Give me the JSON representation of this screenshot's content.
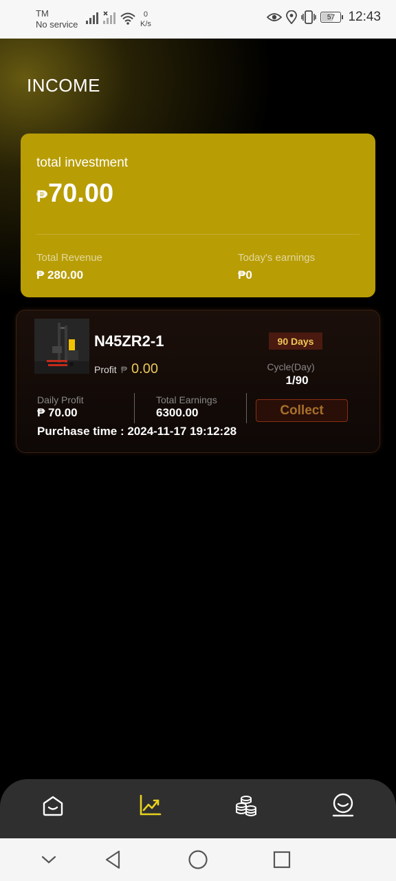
{
  "status_bar": {
    "carrier_line1": "TM",
    "carrier_line2": "No service",
    "net_speed_value": "0",
    "net_speed_unit": "K/s",
    "battery_level": "57",
    "time": "12:43"
  },
  "page": {
    "title": "INCOME"
  },
  "investment_card": {
    "label": "total investment",
    "currency": "₱",
    "amount": "70.00",
    "total_revenue_label": "Total Revenue",
    "total_revenue_value": "₱ 280.00",
    "todays_earnings_label": "Today's earnings",
    "todays_earnings_value": "₱0"
  },
  "product": {
    "name": "N45ZR2-1",
    "badge": "90 Days",
    "profit_label": "Profit",
    "profit_currency": "₱",
    "profit_value": "0.00",
    "cycle_label": "Cycle(Day)",
    "cycle_value": "1/90",
    "daily_profit_label": "Daily Profit",
    "daily_profit_value": "₱ 70.00",
    "total_earnings_label": "Total Earnings",
    "total_earnings_value": "6300.00",
    "collect_label": "Collect",
    "purchase_time": "Purchase time : 2024-11-17 19:12:28"
  },
  "tabs": [
    {
      "icon": "home-icon",
      "active": false
    },
    {
      "icon": "chart-icon",
      "active": true
    },
    {
      "icon": "coins-icon",
      "active": false
    },
    {
      "icon": "profile-icon",
      "active": false
    }
  ],
  "colors": {
    "accent": "#e8d21e",
    "card_gold": "#b89d05",
    "badge_bg": "#4a1a10",
    "badge_text": "#f1c654"
  }
}
